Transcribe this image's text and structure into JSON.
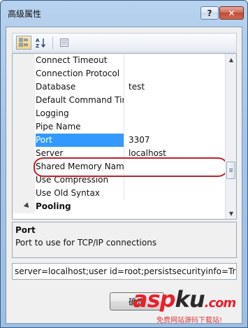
{
  "window": {
    "title": "高级属性",
    "help_label": "?",
    "close_label": "✕"
  },
  "toolbar": {
    "buttons": [
      {
        "icon": "categorized-icon",
        "active": true
      },
      {
        "icon": "sort-alphabetical-icon",
        "active": false
      },
      {
        "icon": "property-pages-icon",
        "active": false
      }
    ]
  },
  "properties": [
    {
      "name": "Connect Timeout",
      "value": ""
    },
    {
      "name": "Connection Protocol",
      "value": ""
    },
    {
      "name": "Database",
      "value": "test"
    },
    {
      "name": "Default Command Tir",
      "value": ""
    },
    {
      "name": "Logging",
      "value": ""
    },
    {
      "name": "Pipe Name",
      "value": ""
    },
    {
      "name": "Port",
      "value": "3307",
      "selected": true
    },
    {
      "name": "Server",
      "value": "localhost"
    },
    {
      "name": "Shared Memory Nam",
      "value": ""
    },
    {
      "name": "Use Compression",
      "value": ""
    },
    {
      "name": "Use Old Syntax",
      "value": ""
    }
  ],
  "category": {
    "name": "Pooling",
    "toggle_icon": "collapse-triangle-icon"
  },
  "description": {
    "title": "Port",
    "text": "Port to use for TCP/IP connections"
  },
  "connection_string": "server=localhost;user id=root;persistsecurityinfo=Tru",
  "ok_button": "确定",
  "watermark": {
    "asp": "asp",
    "ku": "ku",
    "com": ".com",
    "subtitle": "免费网站源码下载站!"
  }
}
